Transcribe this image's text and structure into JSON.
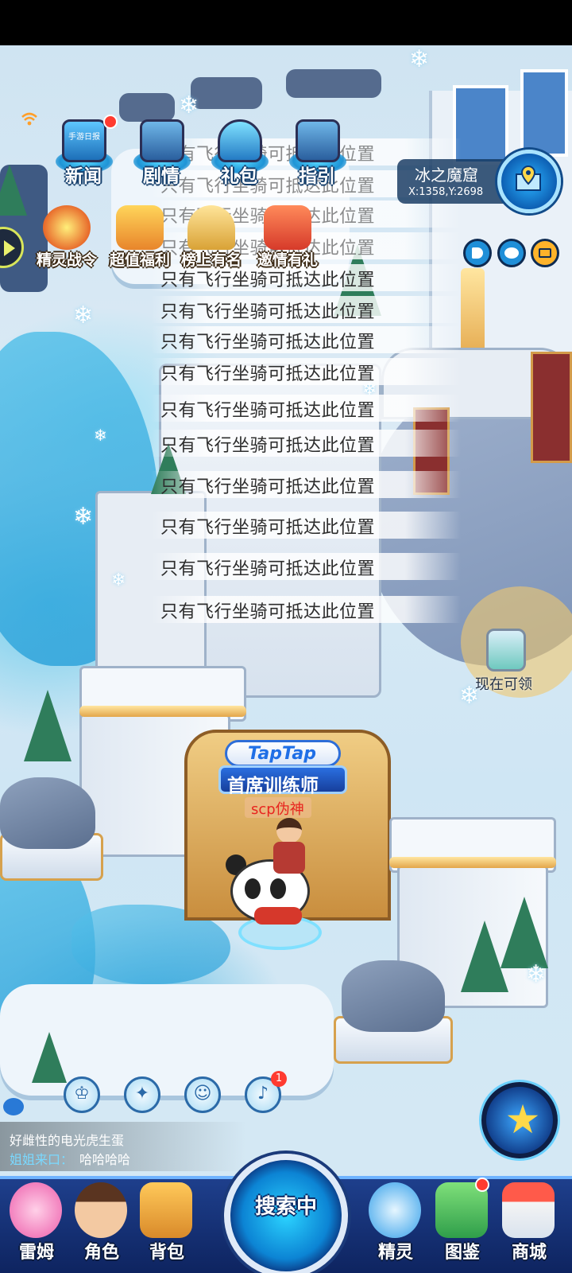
{
  "top_menu": {
    "items": [
      {
        "label": "新闻",
        "icon": "newspaper-tv-icon",
        "art_text": "手游日报",
        "has_badge": true
      },
      {
        "label": "剧情",
        "icon": "story-machine-icon",
        "has_badge": false
      },
      {
        "label": "礼包",
        "icon": "gift-portal-icon",
        "has_badge": false
      },
      {
        "label": "指引",
        "icon": "guide-machine-icon",
        "has_badge": false
      }
    ]
  },
  "events": {
    "items": [
      {
        "label": "精灵战令",
        "icon": "battle-pass-icon"
      },
      {
        "label": "超值福利",
        "icon": "gift-box-icon"
      },
      {
        "label": "榜上有名",
        "icon": "trophy-icon"
      },
      {
        "label": "邀情有礼",
        "icon": "invite-gift-icon"
      }
    ]
  },
  "location": {
    "name": "冰之魔窟",
    "coords": "X:1358,Y:2698",
    "map_icon": "map-pin-icon"
  },
  "side_buttons": [
    "speaker-icon",
    "pet-face-icon",
    "mail-icon"
  ],
  "toasts": {
    "message": "只有飞行坐骑可抵达此位置",
    "count": 15
  },
  "claim": {
    "label": "现在可领",
    "icon": "bottle-icon"
  },
  "player": {
    "badge_top": "TapTap",
    "badge_title": "首席训练师",
    "name": "scp伪神"
  },
  "quick_tools": [
    {
      "icon": "trophy-cup-icon",
      "badge": ""
    },
    {
      "icon": "compass-star-icon",
      "badge": ""
    },
    {
      "icon": "pet-duo-icon",
      "badge": ""
    },
    {
      "icon": "bell-icon",
      "badge": "1"
    }
  ],
  "chat": {
    "line1": "好雌性的电光虎生蛋",
    "sender": "姐姐来口：",
    "message": "哈哈哈哈"
  },
  "bottom_nav": {
    "left": [
      {
        "label": "雷姆",
        "icon": "pink-pet-icon"
      },
      {
        "label": "角色",
        "icon": "character-icon"
      },
      {
        "label": "背包",
        "icon": "backpack-icon"
      }
    ],
    "center_label": "搜索中",
    "right": [
      {
        "label": "精灵",
        "icon": "spirit-icon"
      },
      {
        "label": "图鉴",
        "icon": "pokedex-icon"
      },
      {
        "label": "商城",
        "icon": "shop-icon"
      }
    ]
  },
  "colors": {
    "label_outline": "#16406d",
    "accent_blue": "#1e94d6",
    "badge_red": "#ff3b30",
    "player_name": "#e8251f"
  }
}
